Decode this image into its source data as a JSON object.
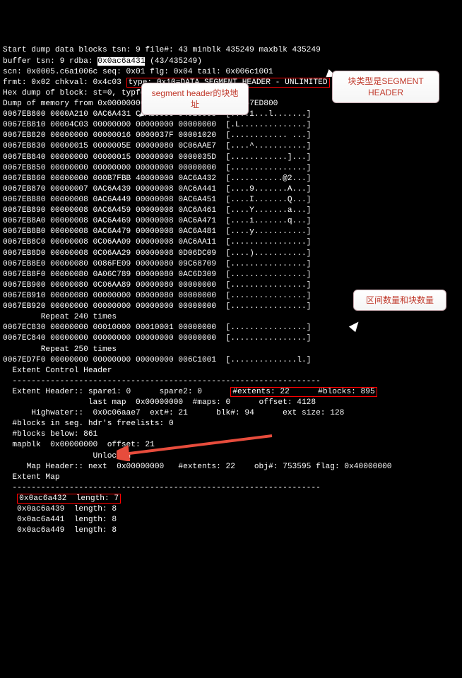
{
  "header": {
    "l1a": "Start dump data blocks tsn: 9 file#: 43 minblk 435249 maxblk 435249",
    "l2a": "buffer tsn: 9 rdba: ",
    "l2b": "0x0ac6a431",
    "l2c": " (43/435249)",
    "l3": "scn: 0x0005.c6a1006c seq: 0x01 flg: 0x04 tail: 0x006c1001",
    "l4a": "frmt: 0x02 chkval: 0x4c03 ",
    "l4b": "type: 0x10=DATA SEGMENT HEADER - UNLIMITED",
    "l5": "Hex dump of block: st=0, typfound=1",
    "l6": "Dump of memory from 0x0000000067EB800 to 0x0000000067ED800"
  },
  "hex": [
    "0067EB800 0000A210 0AC6A431 C6A1006C 04010005  [....1...l.......]",
    "0067EB810 00004C03 00000000 00000000 00000000  [.L..............]",
    "0067EB820 00000000 00000016 0000037F 00001020  [............ ...]",
    "0067EB830 00000015 0000005E 00000080 0C06AAE7  [....^...........]",
    "0067EB840 00000000 00000015 00000000 0000035D  [............]...]",
    "0067EB850 00000000 00000000 00000000 00000000  [................]",
    "0067EB860 00000000 000B7FBB 40000000 0AC6A432  [...........@2...]",
    "0067EB870 00000007 0AC6A439 00000008 0AC6A441  [....9.......A...]",
    "0067EB880 00000008 0AC6A449 00000008 0AC6A451  [....I.......Q...]",
    "0067EB890 00000008 0AC6A459 00000008 0AC6A461  [....Y.......a...]",
    "0067EB8A0 00000008 0AC6A469 00000008 0AC6A471  [....i.......q...]",
    "0067EB8B0 00000008 0AC6A479 00000008 0AC6A481  [....y...........]",
    "0067EB8C0 00000008 0C06AA09 00000008 0AC6AA11  [................]",
    "0067EB8D0 00000008 0C06AA29 00000008 0D06DC09  [....)...........]",
    "0067EB8E0 00000080 0086FE09 00000080 09C68709  [................]",
    "0067EB8F0 00000080 0A06C789 00000080 0AC6D309  [................]",
    "0067EB900 00000080 0C06AA89 00000080 00000000  [................]",
    "0067EB910 00000080 00000000 00000080 00000000  [................]",
    "0067EB920 00000000 00000000 00000000 00000000  [................]"
  ],
  "rep1": "        Repeat 240 times",
  "hex2": [
    "0067EC830 00000000 00010000 00010001 00000000  [................]",
    "0067EC840 00000000 00000000 00000000 00000000  [................]"
  ],
  "rep2": "        Repeat 250 times",
  "hex3": "0067ED7F0 00000000 00000000 00000000 006C1001  [..............l.]",
  "ech_title": "  Extent Control Header",
  "divider": "  -----------------------------------------------------------------",
  "eh1a": "  Extent Header:: spare1: 0      spare2: 0      ",
  "eh1b": "#extents: 22      #blocks: 895",
  "eh2": "                  last map  0x00000000  #maps: 0      offset: 4128",
  "eh3": "      Highwater::  0x0c06aae7  ext#: 21      blk#: 94      ext size: 128",
  "eh4": "  #blocks in seg. hdr's freelists: 0",
  "eh5": "  #blocks below: 861",
  "eh6": "  mapblk  0x00000000  offset: 21",
  "eh7": "                   Unlocked",
  "eh8": "     Map Header:: next  0x00000000   #extents: 22    obj#: 753595 flag: 0x40000000",
  "em_title": "  Extent Map",
  "divider2": "  -----------------------------------------------------------------",
  "em1a": "   ",
  "em1b": "0x0ac6a432  length: 7",
  "em": [
    "   0x0ac6a439  length: 8",
    "   0x0ac6a441  length: 8",
    "   0x0ac6a449  length: 8"
  ],
  "callouts": {
    "c1": "segment header的块地址",
    "c2": "块类型是SEGMENT HEADER",
    "c3": "区间数量和块数量"
  }
}
